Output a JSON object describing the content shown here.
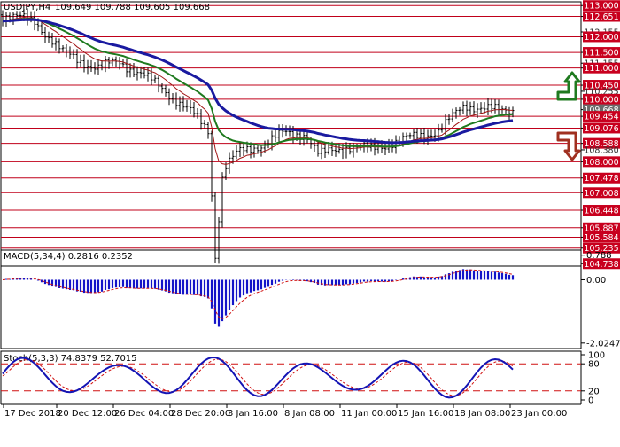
{
  "title": {
    "symbol_text": "USDJPY,H4",
    "ohlc_text": "109.649 109.788 109.605 109.668"
  },
  "price_levels": [
    {
      "label": "113.000",
      "value": 113.0,
      "boxed": true,
      "line": true
    },
    {
      "label": "112.651",
      "value": 112.651,
      "boxed": true,
      "line": true
    },
    {
      "label": "112.155",
      "value": 112.155,
      "boxed": false,
      "line": false
    },
    {
      "label": "112.000",
      "value": 112.0,
      "boxed": true,
      "line": true
    },
    {
      "label": "111.500",
      "value": 111.5,
      "boxed": true,
      "line": true
    },
    {
      "label": "111.155",
      "value": 111.155,
      "boxed": false,
      "line": false
    },
    {
      "label": "111.000",
      "value": 111.0,
      "boxed": true,
      "line": true
    },
    {
      "label": "110.450",
      "value": 110.45,
      "boxed": true,
      "line": true
    },
    {
      "label": "110.255",
      "value": 110.255,
      "boxed": false,
      "line": false
    },
    {
      "label": "110.000",
      "value": 110.0,
      "boxed": true,
      "line": true
    },
    {
      "label": "109.668",
      "value": 109.668,
      "boxed": true,
      "line": false,
      "current": true
    },
    {
      "label": "109.454",
      "value": 109.454,
      "boxed": true,
      "line": true
    },
    {
      "label": "109.076",
      "value": 109.076,
      "boxed": true,
      "line": true
    },
    {
      "label": "108.588",
      "value": 108.588,
      "boxed": true,
      "line": true
    },
    {
      "label": "108.380",
      "value": 108.38,
      "boxed": false,
      "line": false
    },
    {
      "label": "108.000",
      "value": 108.0,
      "boxed": true,
      "line": true
    },
    {
      "label": "107.478",
      "value": 107.478,
      "boxed": true,
      "line": true
    },
    {
      "label": "107.008",
      "value": 107.008,
      "boxed": true,
      "line": true
    },
    {
      "label": "106.448",
      "value": 106.448,
      "boxed": true,
      "line": true
    },
    {
      "label": "105.887",
      "value": 105.887,
      "boxed": true,
      "line": true
    },
    {
      "label": "105.584",
      "value": 105.584,
      "boxed": true,
      "line": true
    },
    {
      "label": "105.235",
      "value": 105.235,
      "boxed": true,
      "line": true
    },
    {
      "label": "104.738",
      "value": 104.738,
      "boxed": true,
      "line": false
    }
  ],
  "macd": {
    "label": "MACD(5,34,4) 0.2816 0.2352",
    "axis_labels": [
      "0.788",
      "0.00",
      "-2.0247"
    ],
    "axis_values": [
      0.788,
      0.0,
      -2.0247
    ]
  },
  "stoch": {
    "label": "Stoch(5,3,3) 74.8379 52.7015",
    "axis_labels": [
      "100",
      "80",
      "20",
      "0"
    ],
    "axis_values": [
      100,
      80,
      20,
      0
    ]
  },
  "time_labels": [
    "17 Dec 2018",
    "20 Dec 12:00",
    "26 Dec 04:00",
    "28 Dec 20:00",
    "3 Jan 16:00",
    "8 Jan 08:00",
    "11 Jan 00:00",
    "15 Jan 16:00",
    "18 Jan 08:00",
    "23 Jan 00:00"
  ],
  "colors": {
    "level_line": "#c0001a",
    "price_box": "#c8001e",
    "current_box": "#6a6a6a",
    "ma_slow": "#1a1aa0",
    "ma_mid": "#1f7a1f",
    "ma_fast": "#a01414",
    "macd_hist": "#1414c8",
    "macd_signal": "#d01010",
    "stoch_main": "#1414b4",
    "stoch_signal": "#d01010",
    "arrow_up": "#1f7a1f",
    "arrow_down": "#a03020"
  },
  "icons": {
    "arrow_up": "arrow-up-icon",
    "arrow_down": "arrow-down-icon"
  }
}
